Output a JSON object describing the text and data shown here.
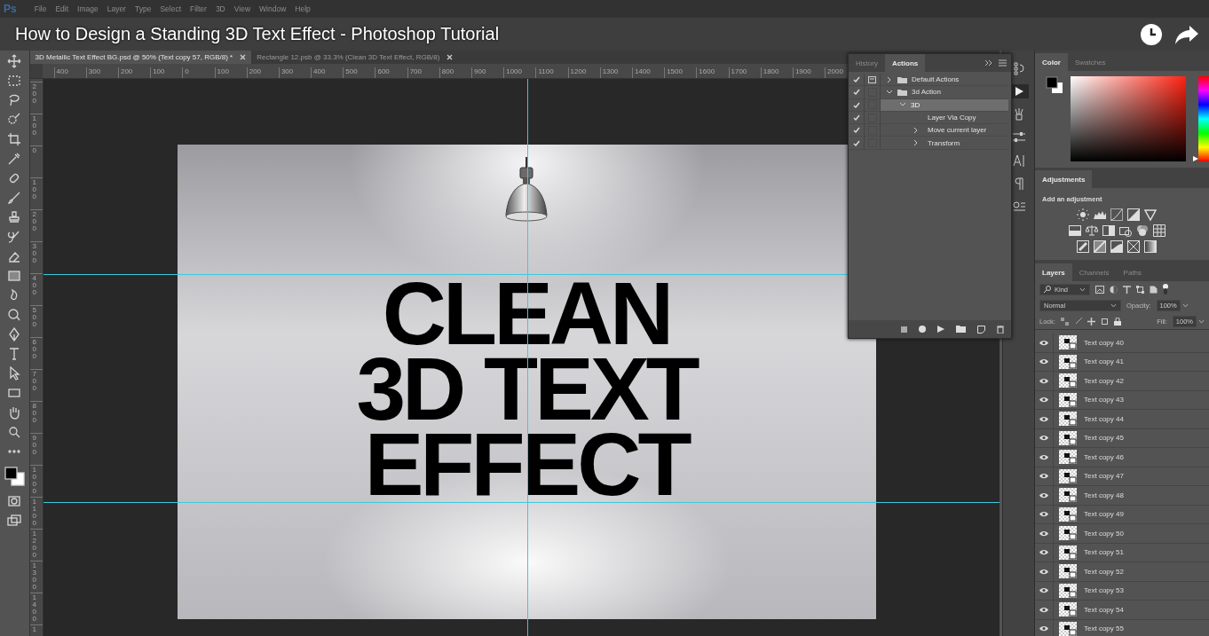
{
  "video": {
    "title": "How to Design a Standing 3D Text Effect - Photoshop Tutorial"
  },
  "app": {
    "logo": "Ps",
    "menu": [
      "File",
      "Edit",
      "Image",
      "Layer",
      "Type",
      "Select",
      "Filter",
      "3D",
      "View",
      "Window",
      "Help"
    ]
  },
  "document_tabs": [
    {
      "label": "3D Metallic Text Effect BG.psd @ 50% (Text copy 57, RGB/8) *",
      "selected": true
    },
    {
      "label": "Rectangle 12.psb @ 33.3% (Clean 3D Text Effect, RGB/8)",
      "selected": false
    }
  ],
  "rulers": {
    "horizontal": [
      "400",
      "300",
      "200",
      "100",
      "0",
      "100",
      "200",
      "300",
      "400",
      "500",
      "600",
      "700",
      "800",
      "900",
      "1000",
      "1100",
      "1200",
      "1300",
      "1400",
      "1500",
      "1600",
      "1700",
      "1800",
      "1900",
      "2000"
    ],
    "vertical": [
      "200",
      "100",
      "0",
      "100",
      "200",
      "300",
      "400",
      "500",
      "600",
      "700",
      "800",
      "900",
      "1000",
      "1100",
      "1200",
      "1300",
      "1400",
      "1"
    ]
  },
  "canvas": {
    "headline": [
      "CLEAN",
      "3D TEXT",
      "EFFECT"
    ]
  },
  "actions_panel": {
    "tabs": [
      {
        "label": "History",
        "selected": false
      },
      {
        "label": "Actions",
        "selected": true
      }
    ],
    "items": [
      {
        "label": "Default Actions",
        "kind": "set",
        "checked": true,
        "dialog": true,
        "expanded": false,
        "selected": false
      },
      {
        "label": "3d Action",
        "kind": "set",
        "checked": true,
        "dialog": false,
        "expanded": true,
        "selected": false,
        "children": [
          {
            "label": "3D",
            "kind": "action",
            "checked": true,
            "dialog": false,
            "expanded": true,
            "selected": true,
            "children": [
              {
                "label": "Layer Via Copy",
                "kind": "command",
                "checked": true,
                "dialog": false,
                "selected": false
              },
              {
                "label": "Move current layer",
                "kind": "command",
                "checked": true,
                "dialog": false,
                "expanded": false,
                "selected": false
              },
              {
                "label": "Transform",
                "kind": "command",
                "checked": true,
                "dialog": false,
                "expanded": false,
                "selected": false
              }
            ]
          }
        ]
      }
    ]
  },
  "color_panel": {
    "tabs": [
      {
        "label": "Color",
        "selected": true
      },
      {
        "label": "Swatches",
        "selected": false
      }
    ],
    "hue_slider": {
      "level": 0
    }
  },
  "adjustments_panel": {
    "tabs": [
      {
        "label": "Adjustments",
        "selected": true
      }
    ],
    "prompt": "Add an adjustment"
  },
  "layers_panel": {
    "tabs": [
      {
        "label": "Layers",
        "selected": true
      },
      {
        "label": "Channels",
        "selected": false
      },
      {
        "label": "Paths",
        "selected": false
      }
    ],
    "filter": "Kind",
    "blend_mode": "Normal",
    "opacity_label": "Opacity:",
    "opacity": "100%",
    "lock_label": "Lock:",
    "fill_label": "Fill:",
    "fill": "100%",
    "layers": [
      {
        "name": "Text copy 40",
        "visible": true
      },
      {
        "name": "Text copy 41",
        "visible": true
      },
      {
        "name": "Text copy 42",
        "visible": true
      },
      {
        "name": "Text copy 43",
        "visible": true
      },
      {
        "name": "Text copy 44",
        "visible": true
      },
      {
        "name": "Text copy 45",
        "visible": true
      },
      {
        "name": "Text copy 46",
        "visible": true
      },
      {
        "name": "Text copy 47",
        "visible": true
      },
      {
        "name": "Text copy 48",
        "visible": true
      },
      {
        "name": "Text copy 49",
        "visible": true
      },
      {
        "name": "Text copy 50",
        "visible": true
      },
      {
        "name": "Text copy 51",
        "visible": true
      },
      {
        "name": "Text copy 52",
        "visible": true
      },
      {
        "name": "Text copy 53",
        "visible": true
      },
      {
        "name": "Text copy 54",
        "visible": true
      },
      {
        "name": "Text copy 55",
        "visible": true
      }
    ]
  }
}
